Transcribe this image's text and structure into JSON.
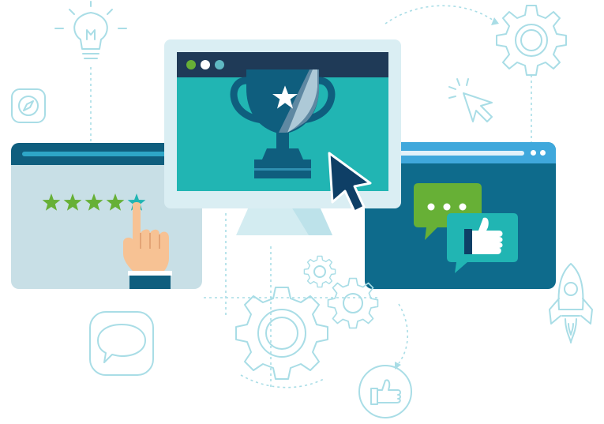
{
  "rating": {
    "filled_stars": 4,
    "total_stars": 5
  },
  "colors": {
    "line_art": "#a9dde6",
    "dark_teal": "#0f5e7e",
    "mid_teal": "#21b5b3",
    "light_panel": "#c8dfe6",
    "bar_blue": "#3fa8dc",
    "green": "#67b036",
    "navy": "#0e3f66"
  },
  "icons": [
    "lightbulb-icon",
    "compass-icon",
    "gear-icon",
    "cursor-click-icon",
    "trophy-icon",
    "star-icon",
    "cursor-arrow-icon",
    "pointing-hand-icon",
    "chat-bubble-icon",
    "thumbs-up-icon",
    "rocket-icon",
    "gears-icon"
  ]
}
